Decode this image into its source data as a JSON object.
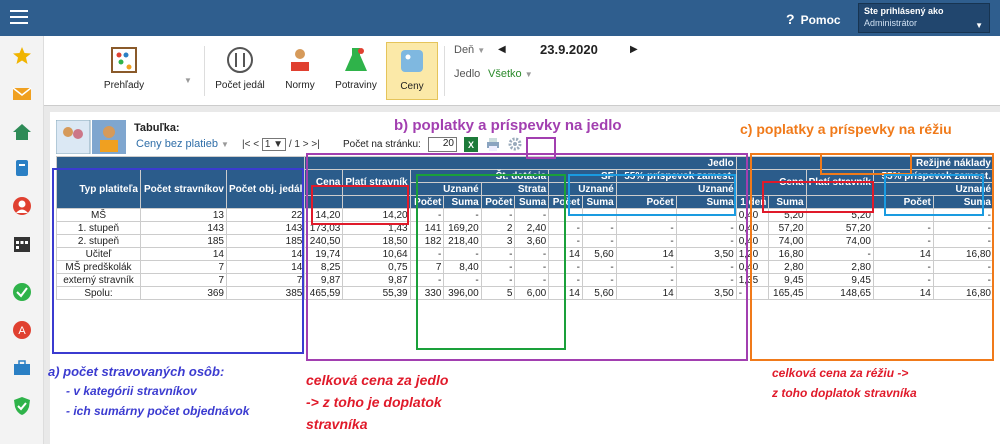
{
  "topbar": {
    "help_label": "Pomoc",
    "help_glyph": "?",
    "user_caption": "Ste prihlásený ako",
    "user_role": "Administrátor"
  },
  "ribbon": {
    "prehlady": "Prehľady",
    "pocet_jedal": "Počet jedál",
    "normy": "Normy",
    "potraviny": "Potraviny",
    "ceny": "Ceny",
    "den_label": "Deň",
    "date": "23.9.2020",
    "jedlo_label": "Jedlo",
    "jedlo_value": "Všetko"
  },
  "toolbar": {
    "tabulka_label": "Tabuľka:",
    "tabulka_value": "Ceny bez platieb",
    "pager_first": "|<",
    "pager_prev": "<",
    "page": "1",
    "page_total": "/ 1",
    "pager_next": ">",
    "pager_last": ">|",
    "pocet_label": "Počet na stránku:",
    "pocet_value": "20"
  },
  "annotations": {
    "b": "b) poplatky a príspevky na jedlo",
    "c": "c) poplatky a príspevky na réžiu",
    "a1": "a) počet stravovaných osôb:",
    "a2": "- v kategórii stravníkov",
    "a3": "- ich sumárny počet objednávok",
    "m1": "celková cena za jedlo",
    "m2": "-> z toho je doplatok",
    "m3": "stravníka",
    "r1": "celková cena za réžiu ->",
    "r2": "z toho doplatok stravníka"
  },
  "headers": {
    "typ": "Typ platiteľa",
    "pocet_str": "Počet stravníkov",
    "pocet_obj": "Počet obj. jedál",
    "jedlo": "Jedlo",
    "cena": "Cena",
    "plati": "Platí stravník",
    "st_dot": "Št. dotácia",
    "sf": "SF",
    "pr55": "55% príspevok zamest.",
    "uznane": "Uznané",
    "strata": "Strata",
    "pocet": "Počet",
    "suma": "Suma",
    "rezijne": "Režijné náklady",
    "den1": "1 deň"
  },
  "rows": [
    [
      "MŠ",
      "13",
      "22",
      "14,20",
      "14,20",
      "-",
      "-",
      "-",
      "-",
      "-",
      "-",
      "-",
      "-",
      "0,40",
      "5,20",
      "5,20",
      "-",
      "-"
    ],
    [
      "1. stupeň",
      "143",
      "143",
      "173,03",
      "1,43",
      "141",
      "169,20",
      "2",
      "2,40",
      "-",
      "-",
      "-",
      "-",
      "0,40",
      "57,20",
      "57,20",
      "-",
      "-"
    ],
    [
      "2. stupeň",
      "185",
      "185",
      "240,50",
      "18,50",
      "182",
      "218,40",
      "3",
      "3,60",
      "-",
      "-",
      "-",
      "-",
      "0,40",
      "74,00",
      "74,00",
      "-",
      "-"
    ],
    [
      "Učiteľ",
      "14",
      "14",
      "19,74",
      "10,64",
      "-",
      "-",
      "-",
      "-",
      "14",
      "5,60",
      "14",
      "3,50",
      "1,20",
      "16,80",
      "-",
      "14",
      "16,80"
    ],
    [
      "MŠ predškolák",
      "7",
      "14",
      "8,25",
      "0,75",
      "7",
      "8,40",
      "-",
      "-",
      "-",
      "-",
      "-",
      "-",
      "0,40",
      "2,80",
      "2,80",
      "-",
      "-"
    ],
    [
      "externý stravník",
      "7",
      "7",
      "9,87",
      "9,87",
      "-",
      "-",
      "-",
      "-",
      "-",
      "-",
      "-",
      "-",
      "1,35",
      "9,45",
      "9,45",
      "-",
      "-"
    ],
    [
      "Spolu:",
      "369",
      "385",
      "465,59",
      "55,39",
      "330",
      "396,00",
      "5",
      "6,00",
      "14",
      "5,60",
      "14",
      "3,50",
      "-",
      "165,45",
      "148,65",
      "14",
      "16,80"
    ]
  ]
}
